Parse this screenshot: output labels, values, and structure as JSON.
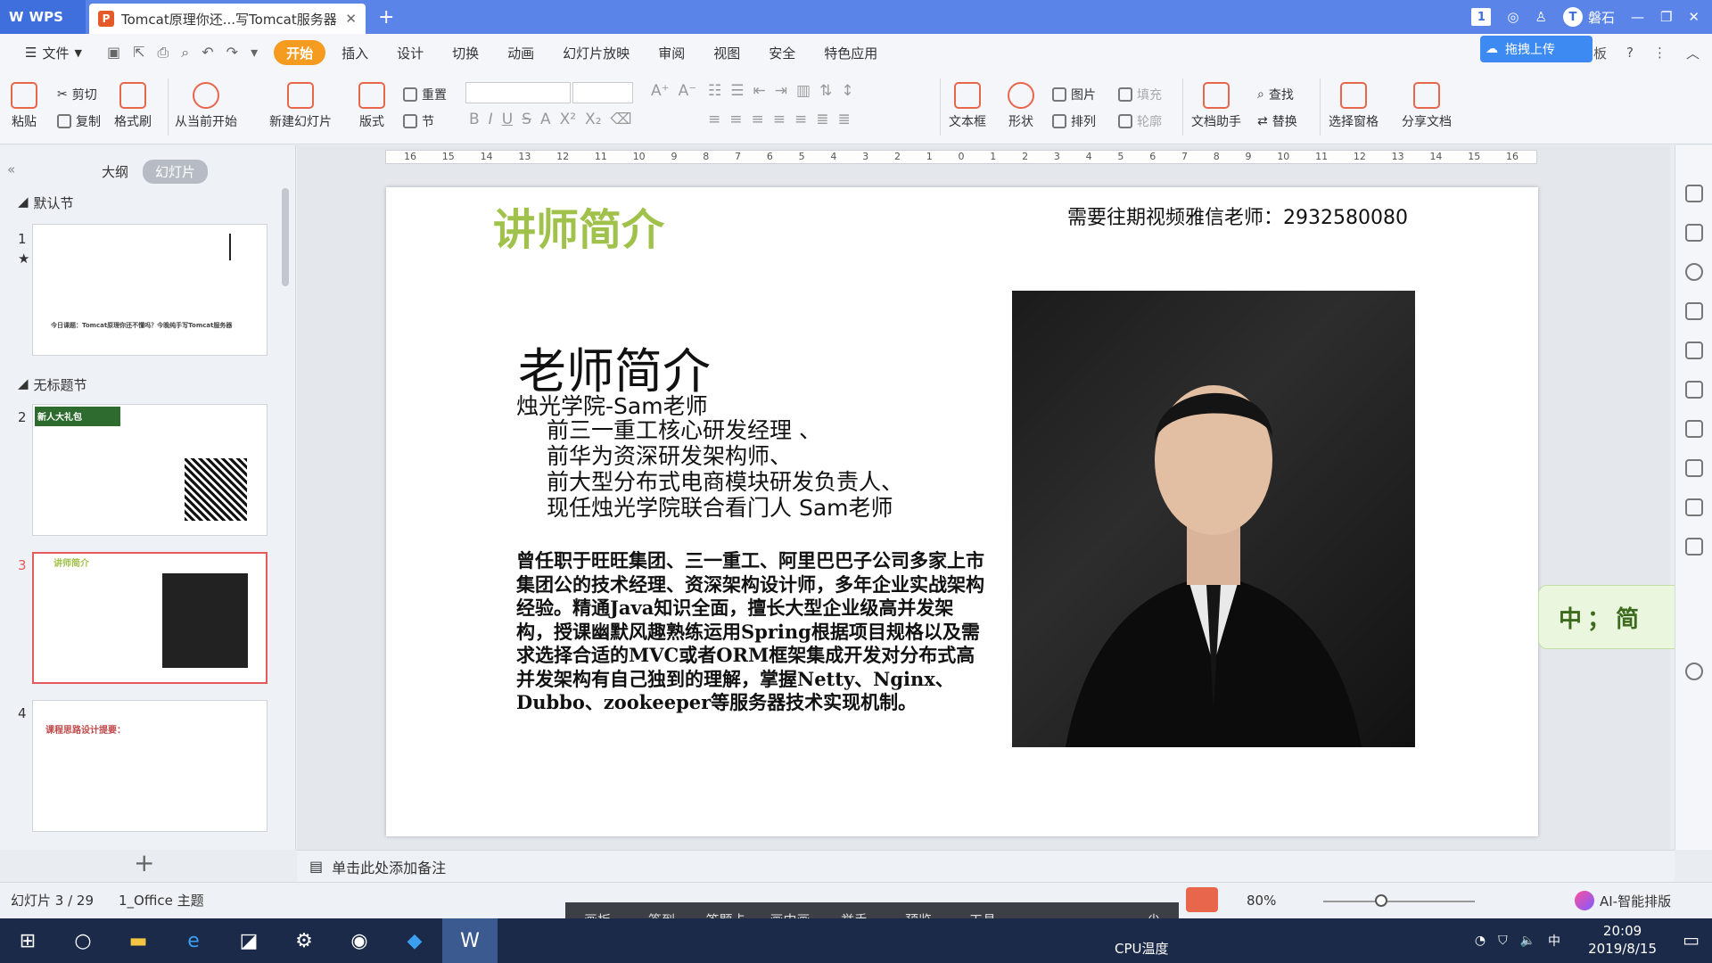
{
  "titlebar": {
    "app_label": "WPS",
    "doc_tab_title": "Tomcat原理你还...写Tomcat服务器",
    "page_badge": "1",
    "user_name": "磐石",
    "user_initial": "T"
  },
  "menubar": {
    "file_label": "文件",
    "items": [
      "开始",
      "插入",
      "设计",
      "切换",
      "动画",
      "幻灯片放映",
      "审阅",
      "视图",
      "安全",
      "特色应用"
    ],
    "upload_label": "拖拽上传",
    "right_label": "板"
  },
  "ribbon": {
    "paste": "粘贴",
    "cut": "剪切",
    "copy": "复制",
    "format_painter": "格式刷",
    "from_current": "从当前开始",
    "new_slide": "新建幻灯片",
    "layout": "版式",
    "reset": "重置",
    "section": "节",
    "textbox": "文本框",
    "shape": "形状",
    "picture": "图片",
    "fill": "填充",
    "arrange": "排列",
    "outline": "轮廓",
    "doc_assistant": "文档助手",
    "find": "查找",
    "replace": "替换",
    "select_pane": "选择窗格",
    "share_doc": "分享文档"
  },
  "leftpanel": {
    "tab_outline": "大纲",
    "tab_slides": "幻灯片",
    "section_default": "默认节",
    "section_untitled": "无标题节",
    "thumb1_text": "今日课题：Tomcat原理你还不懂吗？今晚纯手写Tomcat服务器",
    "thumb2_title": "新人大礼包",
    "thumb3_title": "讲师简介",
    "thumb4_title": "课程思路设计提要："
  },
  "ruler_ticks": [
    "16",
    "15",
    "14",
    "13",
    "12",
    "11",
    "10",
    "9",
    "8",
    "7",
    "6",
    "5",
    "4",
    "3",
    "2",
    "1",
    "0",
    "1",
    "2",
    "3",
    "4",
    "5",
    "6",
    "7",
    "8",
    "9",
    "10",
    "11",
    "12",
    "13",
    "14",
    "15",
    "16"
  ],
  "slide": {
    "title": "讲师简介",
    "contact": "需要往期视频雅信老师：2932580080",
    "heading": "老师简介",
    "org": "烛光学院-Sam老师",
    "roles": [
      "前三一重工核心研发经理 、",
      "前华为资深研发架构师、",
      "前大型分布式电商模块研发负责人、",
      "现任烛光学院联合看门人 Sam老师"
    ],
    "body": "曾任职于旺旺集团、三一重工、阿里巴巴子公司多家上市集团公的技术经理、资深架构设计师，多年企业实战架构经验。精通Java知识全面，擅长大型企业级高并发架构，授课幽默风趣熟练运用Spring根据项目规格以及需求选择合适的MVC或者ORM框架集成开发对分布式高并发架构有自己独到的理解，掌握Netty、Nginx、Dubbo、zookeeper等服务器技术实现机制。"
  },
  "ime_widget": "中；简",
  "notes": "单击此处添加备注",
  "status": {
    "slide_info": "幻灯片 3 / 29",
    "theme": "1_Office 主题",
    "zoom": "80%",
    "ai_label": "AI-智能排版"
  },
  "float_bar": [
    "画板",
    "签到",
    "答题卡",
    "画中画",
    "举手",
    "预览",
    "工具"
  ],
  "taskbar": {
    "cpu_label": "CPU温度",
    "time": "20:09",
    "date": "2019/8/15",
    "ime": "中"
  }
}
